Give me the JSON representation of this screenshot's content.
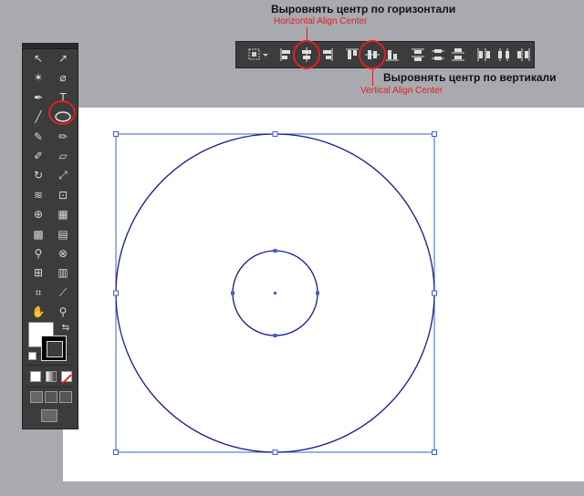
{
  "annotations": {
    "horizontal_ru": "Выровнять центр по горизонтали",
    "horizontal_en": "Horizontal Align Center",
    "vertical_ru": "Выровнять центр по вертикали",
    "vertical_en": "Vertical Align Center"
  },
  "tools": {
    "rows": [
      [
        "selection-arrow-icon",
        "direct-selection-arrow-icon"
      ],
      [
        "magic-wand-icon",
        "lasso-icon"
      ],
      [
        "pen-icon",
        "type-icon"
      ],
      [
        "line-segment-icon",
        "ellipse-icon"
      ],
      [
        "paintbrush-icon",
        "pencil-icon"
      ],
      [
        "blob-brush-icon",
        "eraser-icon"
      ],
      [
        "rotate-icon",
        "scale-icon"
      ],
      [
        "width-icon",
        "free-transform-icon"
      ],
      [
        "shape-builder-icon",
        "perspective-grid-icon"
      ],
      [
        "mesh-icon",
        "gradient-icon"
      ],
      [
        "eyedropper-icon",
        "blend-icon"
      ],
      [
        "symbol-sprayer-icon",
        "column-graph-icon"
      ],
      [
        "artboard-icon",
        "slice-icon"
      ],
      [
        "hand-icon",
        "zoom-icon"
      ]
    ],
    "glyphs": [
      "↖",
      "↗",
      "✶",
      "⌀",
      "✒",
      "T",
      "╱",
      "⬭",
      "✎",
      "✏",
      "✐",
      "▱",
      "↻",
      "⤢",
      "≋",
      "⊡",
      "⊕",
      "▦",
      "▩",
      "▤",
      "⚲",
      "⊗",
      "⊞",
      "▥",
      "⌗",
      "⟋",
      "✋",
      "⚲"
    ]
  },
  "colors": {
    "path": "#1a1a8c",
    "bounding_box": "#3a5fd0",
    "highlight": "#e02020"
  },
  "alignbar": {
    "buttons": [
      "align-to-icon",
      "horizontal-align-left-icon",
      "horizontal-align-center-icon",
      "horizontal-align-right-icon",
      "vertical-align-top-icon",
      "vertical-align-center-icon",
      "vertical-align-bottom-icon",
      "vertical-distribute-top-icon",
      "vertical-distribute-center-icon",
      "vertical-distribute-bottom-icon",
      "horizontal-distribute-left-icon",
      "horizontal-distribute-center-icon",
      "horizontal-distribute-right-icon"
    ]
  }
}
